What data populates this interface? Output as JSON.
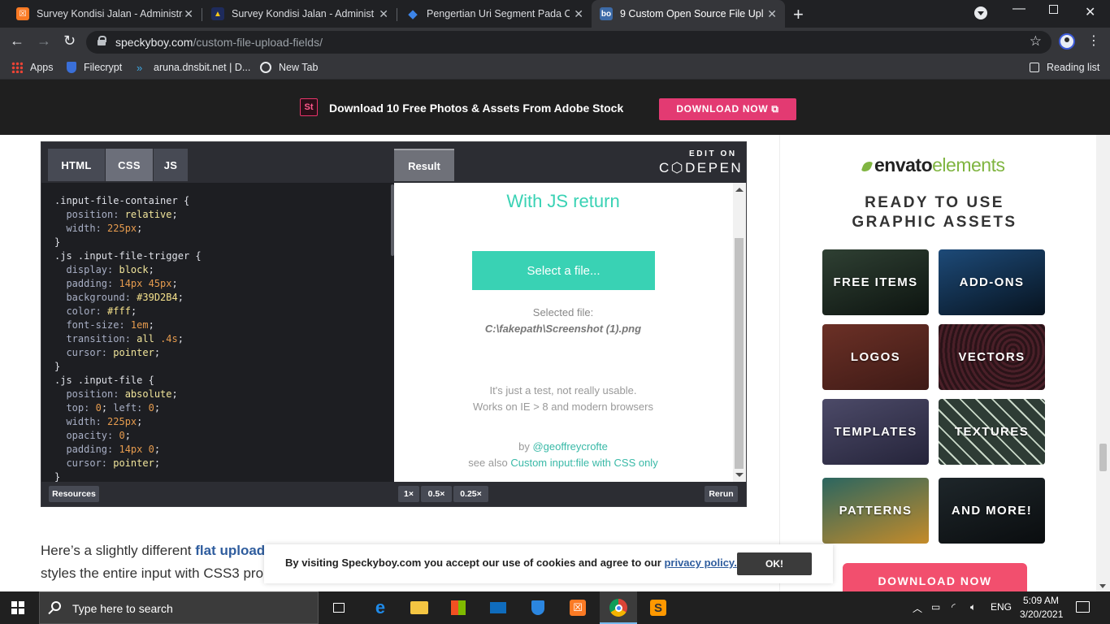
{
  "browser": {
    "tabs": [
      {
        "title": "Survey Kondisi Jalan - Administra",
        "favicon": "xampp-icon",
        "color": "#fb7a24",
        "glyph": "☒"
      },
      {
        "title": "Survey Kondisi Jalan - Administra",
        "favicon": "pu-logo-icon",
        "color": "#f5c518",
        "glyph": "▲"
      },
      {
        "title": "Pengertian Uri Segment Pada Co",
        "favicon": "codeigniter-icon",
        "color": "#3c84e8",
        "glyph": "◇"
      },
      {
        "title": "9 Custom Open Source File Uplo",
        "favicon": "speckyboy-icon",
        "color": "#3d6ba8",
        "glyph": "bo"
      }
    ],
    "new_tab": "+",
    "url_host": "speckyboy.com",
    "url_path": "/custom-file-upload-fields/",
    "bookmarks": [
      {
        "label": "Apps",
        "icon": "apps-grid-icon"
      },
      {
        "label": "Filecrypt",
        "icon": "shield-icon"
      },
      {
        "label": "aruna.dnsbit.net | D...",
        "icon": "arrow-icon"
      },
      {
        "label": "New Tab",
        "icon": "globe-icon"
      }
    ],
    "reading_list": "Reading list"
  },
  "banner": {
    "logo": "St",
    "text": "Download 10 Free Photos & Assets From Adobe Stock",
    "button": "DOWNLOAD NOW ⧉"
  },
  "codepen": {
    "tabs": [
      "HTML",
      "CSS",
      "JS"
    ],
    "active_tab": "CSS",
    "result_tab": "Result",
    "edit_on": "EDIT ON",
    "brand": "C⬡DEPEN",
    "code_lines": [
      [
        [
          "sel",
          ".input-file-container {"
        ]
      ],
      [
        [
          "prop",
          "  position: "
        ],
        [
          "val",
          "relative"
        ],
        [
          "sel",
          ";"
        ]
      ],
      [
        [
          "prop",
          "  width: "
        ],
        [
          "num",
          "225px"
        ],
        [
          "sel",
          ";"
        ]
      ],
      [
        [
          "sel",
          "}"
        ]
      ],
      [
        [
          "sel",
          ".js .input-file-trigger {"
        ]
      ],
      [
        [
          "prop",
          "  display: "
        ],
        [
          "val",
          "block"
        ],
        [
          "sel",
          ";"
        ]
      ],
      [
        [
          "prop",
          "  padding: "
        ],
        [
          "num",
          "14px 45px"
        ],
        [
          "sel",
          ";"
        ]
      ],
      [
        [
          "prop",
          "  background: "
        ],
        [
          "str",
          "#39D2B4"
        ],
        [
          "sel",
          ";"
        ]
      ],
      [
        [
          "prop",
          "  color: "
        ],
        [
          "str",
          "#fff"
        ],
        [
          "sel",
          ";"
        ]
      ],
      [
        [
          "prop",
          "  font-size: "
        ],
        [
          "num",
          "1em"
        ],
        [
          "sel",
          ";"
        ]
      ],
      [
        [
          "prop",
          "  transition: "
        ],
        [
          "val",
          "all "
        ],
        [
          "num",
          ".4s"
        ],
        [
          "sel",
          ";"
        ]
      ],
      [
        [
          "prop",
          "  cursor: "
        ],
        [
          "val",
          "pointer"
        ],
        [
          "sel",
          ";"
        ]
      ],
      [
        [
          "sel",
          "}"
        ]
      ],
      [
        [
          "sel",
          ".js .input-file {"
        ]
      ],
      [
        [
          "prop",
          "  position: "
        ],
        [
          "val",
          "absolute"
        ],
        [
          "sel",
          ";"
        ]
      ],
      [
        [
          "prop",
          "  top: "
        ],
        [
          "num",
          "0"
        ],
        [
          "sel",
          "; "
        ],
        [
          "prop",
          "left: "
        ],
        [
          "num",
          "0"
        ],
        [
          "sel",
          ";"
        ]
      ],
      [
        [
          "prop",
          "  width: "
        ],
        [
          "num",
          "225px"
        ],
        [
          "sel",
          ";"
        ]
      ],
      [
        [
          "prop",
          "  opacity: "
        ],
        [
          "num",
          "0"
        ],
        [
          "sel",
          ";"
        ]
      ],
      [
        [
          "prop",
          "  padding: "
        ],
        [
          "num",
          "14px 0"
        ],
        [
          "sel",
          ";"
        ]
      ],
      [
        [
          "prop",
          "  cursor: "
        ],
        [
          "val",
          "pointer"
        ],
        [
          "sel",
          ";"
        ]
      ],
      [
        [
          "sel",
          "}"
        ]
      ]
    ],
    "result": {
      "title": "With JS return",
      "button": "Select a file...",
      "selected_label": "Selected file:",
      "selected_path": "C:\\fakepath\\Screenshot (1).png",
      "note1": "It's just a test, not really usable.",
      "note2": "Works on IE > 8 and modern browsers",
      "by": "by ",
      "author": "@geoffreycrofte",
      "see_also": "see also ",
      "see_also_link": "Custom input:file with CSS only"
    },
    "footer": {
      "resources": "Resources",
      "zoom": [
        "1×",
        "0.5×",
        "0.25×"
      ],
      "rerun": "Rerun"
    }
  },
  "article": {
    "text_before": "Here’s a slightly different ",
    "link": "flat upload",
    "text_after": "styles the entire input with CSS3 pro"
  },
  "sidebar": {
    "brand_prefix": "envato",
    "brand_suffix": "elements",
    "heading_line1": "READY TO USE",
    "heading_line2": "GRAPHIC ASSETS",
    "tiles": [
      {
        "label": "FREE ITEMS",
        "bg": "#1d2a22"
      },
      {
        "label": "ADD-ONS",
        "bg": "#0f2438"
      },
      {
        "label": "LOGOS",
        "bg": "#5a2a22"
      },
      {
        "label": "VECTORS",
        "bg": "#3a1f24"
      },
      {
        "label": "TEMPLATES",
        "bg": "#3b3a52"
      },
      {
        "label": "TEXTURES",
        "bg": "#2c3a33"
      },
      {
        "label": "PATTERNS",
        "bg": "#1f3f46"
      },
      {
        "label": "AND MORE!",
        "bg": "#151a1d"
      }
    ],
    "download": "DOWNLOAD NOW"
  },
  "cookie": {
    "text": "By visiting Speckyboy.com you accept our use of cookies and agree to our ",
    "link": "privacy policy.",
    "ok": "OK!"
  },
  "taskbar": {
    "search_placeholder": "Type here to search",
    "language": "ENG",
    "time": "5:09 AM",
    "date": "3/20/2021"
  }
}
